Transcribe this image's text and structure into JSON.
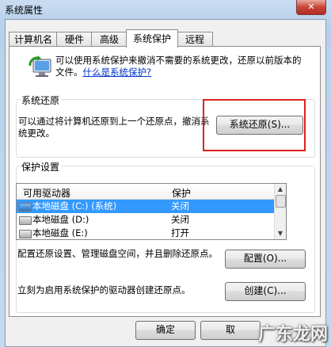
{
  "window": {
    "title": "系统属性",
    "close_glyph": "✕"
  },
  "tabs": [
    {
      "label": "计算机名"
    },
    {
      "label": "硬件"
    },
    {
      "label": "高级"
    },
    {
      "label": "系统保护"
    },
    {
      "label": "远程"
    }
  ],
  "intro": {
    "text": "可以使用系统保护来撤消不需要的系统更改，还原以前版本的文件。",
    "link": "什么是系统保护?"
  },
  "restore": {
    "title": "系统还原",
    "desc": "可以通过将计算机还原到上一个还原点，撤消系统更改。",
    "button": "系统还原(S)..."
  },
  "protection": {
    "title": "保护设置",
    "columns": [
      "可用驱动器",
      "保护"
    ],
    "rows": [
      {
        "drive": "本地磁盘 (C:) (系统)",
        "status": "关闭",
        "selected": true,
        "icon": "windows-drive-icon"
      },
      {
        "drive": "本地磁盘 (D:)",
        "status": "关闭",
        "selected": false,
        "icon": "drive-icon"
      },
      {
        "drive": "本地磁盘 (E:)",
        "status": "打开",
        "selected": false,
        "icon": "drive-icon"
      }
    ],
    "configure_text": "配置还原设置、管理磁盘空间，并且删除还原点。",
    "configure_button": "配置(O)...",
    "create_text": "立刻为启用系统保护的驱动器创建还原点。",
    "create_button": "创建(C)..."
  },
  "footer": {
    "ok": "确定",
    "cancel": "取"
  },
  "watermark": "广东龙网",
  "colors": {
    "selection": "#3399ff",
    "highlight_box": "#e02020",
    "link": "#0033cc"
  }
}
